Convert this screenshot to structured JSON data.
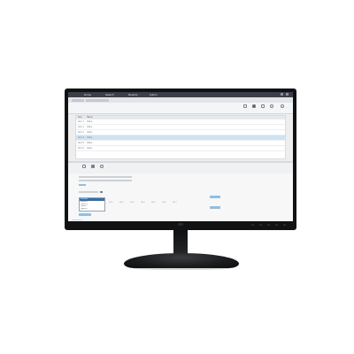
{
  "app": {
    "menu": [
      "Home",
      "Search",
      "Reports",
      "Admin"
    ],
    "breadcrumb": [
      "Item",
      "Information"
    ]
  },
  "toolbar": {
    "tools": [
      {
        "icon": "print-icon",
        "label": "Print"
      },
      {
        "icon": "save-icon",
        "label": "Save"
      },
      {
        "icon": "export-icon",
        "label": "Export"
      },
      {
        "icon": "refresh-icon",
        "label": "Refresh"
      },
      {
        "icon": "help-icon",
        "label": "Help"
      }
    ]
  },
  "table": {
    "columns": [
      "Item",
      "Name"
    ],
    "rows": [
      [
        "Item 1",
        "Value"
      ],
      [
        "Item 2",
        "Value"
      ],
      [
        "Item 3",
        "Value"
      ],
      [
        "Item 4",
        "Value"
      ],
      [
        "Item 5",
        "Value"
      ],
      [
        "Item 6",
        "Value"
      ]
    ],
    "selected_row": 3
  },
  "bottom_toolbar": {
    "tools": [
      {
        "icon": "list-icon",
        "label": "List"
      },
      {
        "icon": "grid-icon",
        "label": "Grid"
      },
      {
        "icon": "undo-icon",
        "label": "Undo"
      }
    ]
  },
  "form": {
    "fields": [
      "Name",
      "Type",
      "Status"
    ],
    "section_label": "Options",
    "list_options": [
      "Selected",
      "Option A",
      "Option B",
      "Option C",
      "Option D"
    ],
    "columns": [
      "Col 1",
      "Col 2",
      "Col 3",
      "Col 4",
      "Col 5",
      "Col 6",
      "Col 7"
    ]
  },
  "colors": {
    "bezel": "#111214",
    "menubar": "#3b4048",
    "selection": "#cfe3f2",
    "accent_button": "#8fc0e0"
  }
}
